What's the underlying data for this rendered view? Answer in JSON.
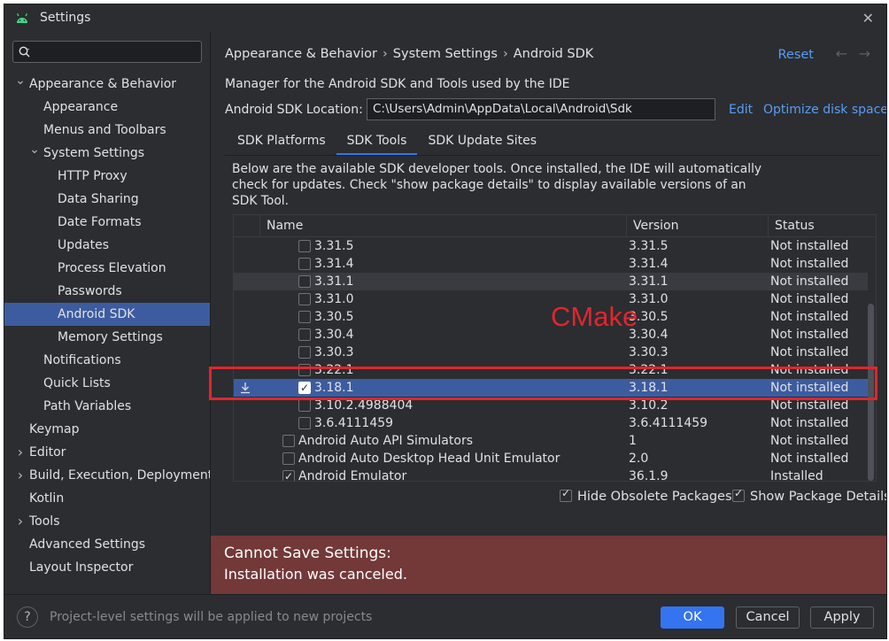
{
  "window": {
    "title": "Settings"
  },
  "search": {
    "placeholder": "",
    "value": ""
  },
  "sidebar": {
    "items": [
      {
        "label": "Appearance & Behavior",
        "indent": 0,
        "chevron": "down",
        "selected": false
      },
      {
        "label": "Appearance",
        "indent": 1,
        "chevron": "",
        "selected": false
      },
      {
        "label": "Menus and Toolbars",
        "indent": 1,
        "chevron": "",
        "selected": false
      },
      {
        "label": "System Settings",
        "indent": 1,
        "chevron": "down",
        "selected": false
      },
      {
        "label": "HTTP Proxy",
        "indent": 2,
        "chevron": "",
        "selected": false
      },
      {
        "label": "Data Sharing",
        "indent": 2,
        "chevron": "",
        "selected": false
      },
      {
        "label": "Date Formats",
        "indent": 2,
        "chevron": "",
        "selected": false
      },
      {
        "label": "Updates",
        "indent": 2,
        "chevron": "",
        "selected": false
      },
      {
        "label": "Process Elevation",
        "indent": 2,
        "chevron": "",
        "selected": false
      },
      {
        "label": "Passwords",
        "indent": 2,
        "chevron": "",
        "selected": false
      },
      {
        "label": "Android SDK",
        "indent": 2,
        "chevron": "",
        "selected": true
      },
      {
        "label": "Memory Settings",
        "indent": 2,
        "chevron": "",
        "selected": false
      },
      {
        "label": "Notifications",
        "indent": 1,
        "chevron": "",
        "selected": false
      },
      {
        "label": "Quick Lists",
        "indent": 1,
        "chevron": "",
        "selected": false
      },
      {
        "label": "Path Variables",
        "indent": 1,
        "chevron": "",
        "selected": false
      },
      {
        "label": "Keymap",
        "indent": 0,
        "chevron": "",
        "selected": false
      },
      {
        "label": "Editor",
        "indent": 0,
        "chevron": "right",
        "selected": false
      },
      {
        "label": "Build, Execution, Deployment",
        "indent": 0,
        "chevron": "right",
        "selected": false
      },
      {
        "label": "Kotlin",
        "indent": 0,
        "chevron": "",
        "selected": false
      },
      {
        "label": "Tools",
        "indent": 0,
        "chevron": "right",
        "selected": false
      },
      {
        "label": "Advanced Settings",
        "indent": 0,
        "chevron": "",
        "selected": false
      },
      {
        "label": "Layout Inspector",
        "indent": 0,
        "chevron": "",
        "selected": false
      }
    ]
  },
  "main": {
    "breadcrumb": [
      "Appearance & Behavior",
      "System Settings",
      "Android SDK"
    ],
    "reset_label": "Reset",
    "description": "Manager for the Android SDK and Tools used by the IDE",
    "sdk_location_label": "Android SDK Location:",
    "sdk_location_value": "C:\\Users\\Admin\\AppData\\Local\\Android\\Sdk",
    "edit_label": "Edit",
    "optimize_label": "Optimize disk space",
    "tabs": [
      {
        "label": "SDK Platforms",
        "active": false
      },
      {
        "label": "SDK Tools",
        "active": true
      },
      {
        "label": "SDK Update Sites",
        "active": false
      }
    ],
    "tab_description": "Below are the available SDK developer tools. Once installed, the IDE will automatically check for updates. Check \"show package details\" to display available versions of an SDK Tool.",
    "table": {
      "columns": [
        "Name",
        "Version",
        "Status"
      ],
      "rows": [
        {
          "name": "3.31.5",
          "version": "3.31.5",
          "status": "Not installed",
          "checked": false,
          "level": 2,
          "alt": false,
          "selected": false,
          "download": false
        },
        {
          "name": "3.31.4",
          "version": "3.31.4",
          "status": "Not installed",
          "checked": false,
          "level": 2,
          "alt": false,
          "selected": false,
          "download": false
        },
        {
          "name": "3.31.1",
          "version": "3.31.1",
          "status": "Not installed",
          "checked": false,
          "level": 2,
          "alt": true,
          "selected": false,
          "download": false
        },
        {
          "name": "3.31.0",
          "version": "3.31.0",
          "status": "Not installed",
          "checked": false,
          "level": 2,
          "alt": false,
          "selected": false,
          "download": false
        },
        {
          "name": "3.30.5",
          "version": "3.30.5",
          "status": "Not installed",
          "checked": false,
          "level": 2,
          "alt": false,
          "selected": false,
          "download": false
        },
        {
          "name": "3.30.4",
          "version": "3.30.4",
          "status": "Not installed",
          "checked": false,
          "level": 2,
          "alt": false,
          "selected": false,
          "download": false
        },
        {
          "name": "3.30.3",
          "version": "3.30.3",
          "status": "Not installed",
          "checked": false,
          "level": 2,
          "alt": false,
          "selected": false,
          "download": false
        },
        {
          "name": "3.22.1",
          "version": "3.22.1",
          "status": "Not installed",
          "checked": false,
          "level": 2,
          "alt": false,
          "selected": false,
          "download": false
        },
        {
          "name": "3.18.1",
          "version": "3.18.1",
          "status": "Not installed",
          "checked": true,
          "level": 2,
          "alt": false,
          "selected": true,
          "download": true
        },
        {
          "name": "3.10.2.4988404",
          "version": "3.10.2",
          "status": "Not installed",
          "checked": false,
          "level": 2,
          "alt": false,
          "selected": false,
          "download": false
        },
        {
          "name": "3.6.4111459",
          "version": "3.6.4111459",
          "status": "Not installed",
          "checked": false,
          "level": 2,
          "alt": false,
          "selected": false,
          "download": false
        },
        {
          "name": "Android Auto API Simulators",
          "version": "1",
          "status": "Not installed",
          "checked": false,
          "level": 1,
          "alt": false,
          "selected": false,
          "download": false
        },
        {
          "name": "Android Auto Desktop Head Unit Emulator",
          "version": "2.0",
          "status": "Not installed",
          "checked": false,
          "level": 1,
          "alt": false,
          "selected": false,
          "download": false
        },
        {
          "name": "Android Emulator",
          "version": "36.1.9",
          "status": "Installed",
          "checked": true,
          "level": 1,
          "alt": false,
          "selected": false,
          "download": false
        }
      ]
    },
    "annotation_text": "CMake",
    "hide_obsolete_label": "Hide Obsolete Packages",
    "show_details_label": "Show Package Details",
    "error_title": "Cannot Save Settings:",
    "error_message": "Installation was canceled."
  },
  "footer": {
    "help_label": "?",
    "note": "Project-level settings will be applied to new projects",
    "ok_label": "OK",
    "cancel_label": "Cancel",
    "apply_label": "Apply"
  },
  "colors": {
    "background": "#2b2d30",
    "selection": "#3d5ca0",
    "link": "#589df6",
    "accent": "#3574f0",
    "error_bg": "#733838",
    "annotation": "#e2252e"
  }
}
